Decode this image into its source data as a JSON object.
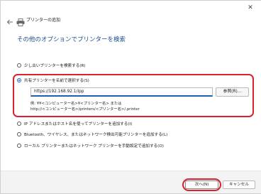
{
  "window": {
    "close_glyph": "✕",
    "wizard_title": "プリンターの追加"
  },
  "heading": "その他のオプションでプリンターを検索",
  "options": [
    {
      "label": "少し古いプリンターを検索する(R)",
      "selected": false
    },
    {
      "label": "共有プリンターを名前で選択する(S)",
      "selected": true
    },
    {
      "label": "IP アドレスまたはホスト名を使ってプリンターを追加する(I)",
      "selected": false
    },
    {
      "label": "Bluetooth、ワイヤレス、またはネットワーク検出可能プリンターを追加する(L)",
      "selected": false
    },
    {
      "label": "ローカル プリンターまたはネットワーク プリンターを手動設定で追加する(O)",
      "selected": false
    }
  ],
  "shared_printer": {
    "input_value": "https://192.168.92.1/ipp",
    "browse_label": "参照(R)...",
    "example_line1": "例: ¥¥<コンピューター名>¥<プリンター名> または",
    "example_line2": "http://<コンピューター名>/printers/<プリンター名>/.printer"
  },
  "footer": {
    "next_label": "次へ(N)",
    "cancel_label": "キャンセル"
  },
  "colors": {
    "accent": "#1a62b8",
    "heading": "#1a4f8f",
    "highlight": "#d9232e"
  },
  "icons": [
    "close-icon",
    "back-arrow-icon",
    "printer-icon"
  ]
}
